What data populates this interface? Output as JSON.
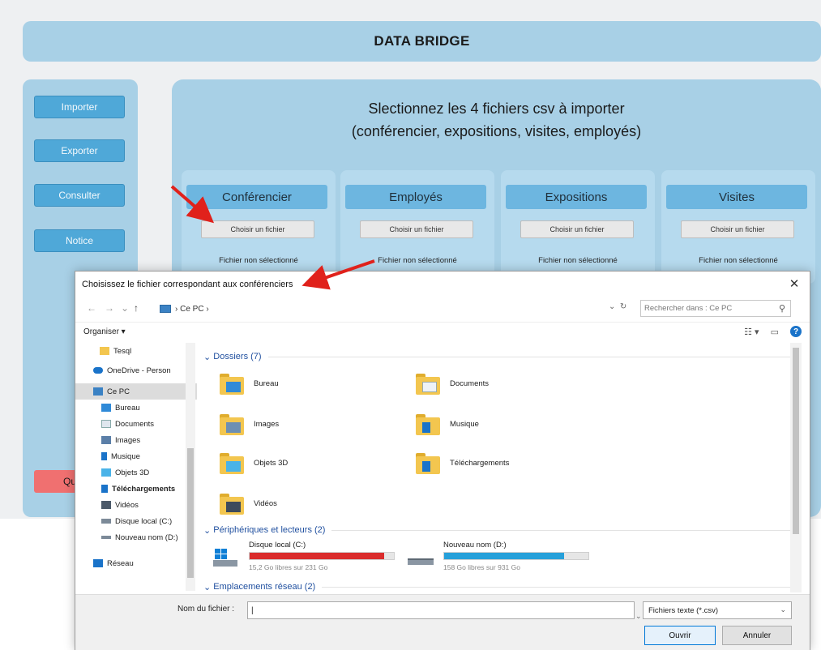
{
  "app": {
    "title": "DATA BRIDGE",
    "nav": [
      "Importer",
      "Exporter",
      "Consulter",
      "Notice"
    ],
    "quit_label": "Qu",
    "main_title_line1": "Slectionnez les 4 fichiers csv à importer",
    "main_title_line2": "(conférencier, expositions, visites, employés)",
    "cards": [
      {
        "title": "Conférencier",
        "button": "Choisir un fichier",
        "status": "Fichier non sélectionné"
      },
      {
        "title": "Employés",
        "button": "Choisir un fichier",
        "status": "Fichier non sélectionné"
      },
      {
        "title": "Expositions",
        "button": "Choisir un fichier",
        "status": "Fichier non sélectionné"
      },
      {
        "title": "Visites",
        "button": "Choisir un fichier",
        "status": "Fichier non sélectionné"
      }
    ]
  },
  "dialog": {
    "title": "Choisissez le fichier correspondant aux conférenciers",
    "close": "✕",
    "address": "Ce PC",
    "search_placeholder": "Rechercher dans : Ce PC",
    "organize": "Organiser ▾",
    "tree": [
      {
        "label": "Tesql",
        "icon": "folder-icon"
      },
      {
        "label": "OneDrive - Person",
        "icon": "cloud-icon"
      },
      {
        "label": "Ce PC",
        "icon": "pc-icon"
      },
      {
        "label": "Bureau",
        "icon": "desktop-icon"
      },
      {
        "label": "Documents",
        "icon": "documents-icon"
      },
      {
        "label": "Images",
        "icon": "images-icon"
      },
      {
        "label": "Musique",
        "icon": "music-icon"
      },
      {
        "label": "Objets 3D",
        "icon": "objects3d-icon"
      },
      {
        "label": "Téléchargements",
        "icon": "downloads-icon"
      },
      {
        "label": "Vidéos",
        "icon": "videos-icon"
      },
      {
        "label": "Disque local (C:)",
        "icon": "disk-icon"
      },
      {
        "label": "Nouveau nom (D:)",
        "icon": "disk-icon"
      },
      {
        "label": "Réseau",
        "icon": "network-icon"
      }
    ],
    "group_folders": "Dossiers (7)",
    "folders": [
      "Bureau",
      "Documents",
      "Images",
      "Musique",
      "Objets 3D",
      "Téléchargements",
      "Vidéos"
    ],
    "group_devices": "Périphériques et lecteurs (2)",
    "drives": [
      {
        "name": "Disque local (C:)",
        "free": "15,2 Go libres sur 231 Go",
        "used_fraction": 0.93,
        "color": "#da2c2c"
      },
      {
        "name": "Nouveau nom (D:)",
        "free": "158 Go libres sur 931 Go",
        "used_fraction": 0.83,
        "color": "#26a0da"
      }
    ],
    "group_network": "Emplacements réseau (2)",
    "filename_label": "Nom du fichier :",
    "filename_value": "|",
    "filetype": "Fichiers texte (*.csv)",
    "open": "Ouvrir",
    "cancel": "Annuler"
  }
}
